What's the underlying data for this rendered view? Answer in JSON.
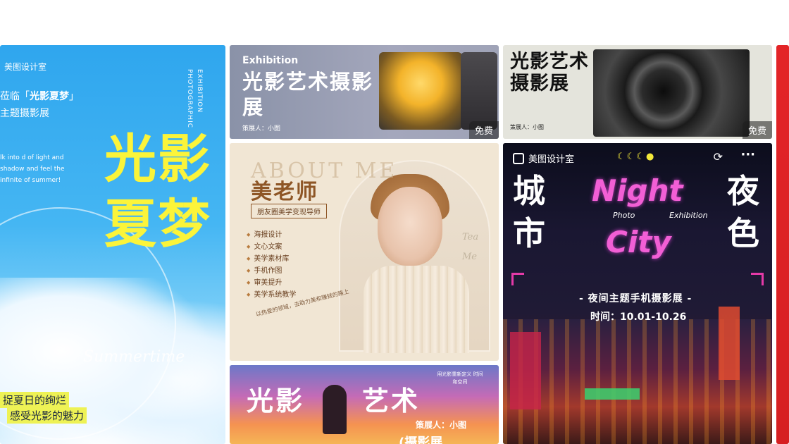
{
  "cards": {
    "summer": {
      "brand": "美图设计室",
      "line1_pre": "莅临「",
      "line1_bold": "光影夏梦",
      "line1_post": "」",
      "line2": "主题摄影展",
      "vertical1": "EXHIBITION",
      "vertical2": "PHOTOGRAPHIC",
      "english": "lk into d of light and shadow and feel the infinite of summer!",
      "big_title": "光影夏梦",
      "script": "Summertime",
      "highlight1": "捉夏日的绚烂",
      "highlight2": "感受光影的魅力"
    },
    "exhibition": {
      "tag": "Exhibition",
      "title": "光影艺术摄影展",
      "curator": "策展人：小图",
      "free_badge": "免费"
    },
    "camera": {
      "title": "光影艺术摄影展",
      "curator": "策展人：小图",
      "free_badge": "免费"
    },
    "teacher": {
      "about": "ABOUT ME",
      "name": "美老师",
      "subtitle": "朋友圈美学变现导师",
      "items": [
        "海报设计",
        "文心文案",
        "美学素材库",
        "手机作图",
        "审美提升",
        "美学系统教学"
      ],
      "quote": "以热爱的领域，去助力美和赚钱的路上",
      "script": "Tea Me"
    },
    "light_art": {
      "title_left": "光影",
      "title_right": "艺术",
      "curator": "策展人：小图",
      "bottom_title": "(摄影展",
      "note": "用光影重新定义 时间和空间"
    },
    "night_city": {
      "brand": "美图设计室",
      "moons": "☾☾☾●",
      "title_left": "城市",
      "title_right": "夜色",
      "night": "Night",
      "city": "City",
      "photo": "Photo",
      "exhibition": "Exhibition",
      "theme": "- 夜间主题手机摄影展 -",
      "dates": "时间：10.01-10.26"
    }
  },
  "colors": {
    "summer_bg": "#2fa6ee",
    "summer_title": "#fbf43a",
    "night_neon": "#f25fd5",
    "teacher_accent": "#8e5626",
    "partial_card": "#e32427"
  }
}
